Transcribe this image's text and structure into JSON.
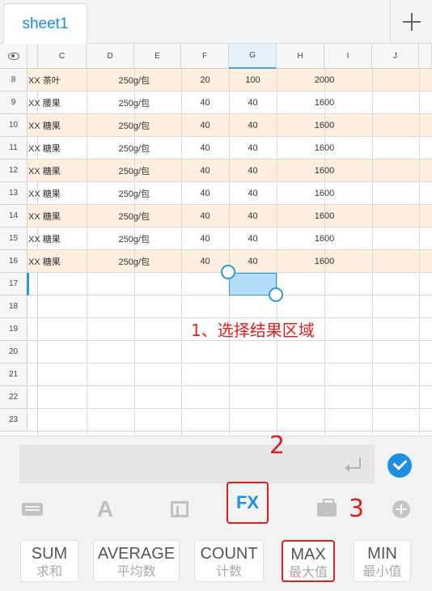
{
  "tabs": {
    "active": "sheet1"
  },
  "grid": {
    "columns": [
      "C",
      "D",
      "E",
      "F",
      "G",
      "H",
      "I",
      "J"
    ],
    "rows": [
      {
        "num": "8",
        "name": "XX 茶叶",
        "spec": "250g/包",
        "f": "20",
        "g": "100",
        "h": "2000"
      },
      {
        "num": "9",
        "name": "XX 腰果",
        "spec": "250g/包",
        "f": "40",
        "g": "40",
        "h": "1600"
      },
      {
        "num": "10",
        "name": "XX 糖果",
        "spec": "250g/包",
        "f": "40",
        "g": "40",
        "h": "1600"
      },
      {
        "num": "11",
        "name": "XX 糖果",
        "spec": "250g/包",
        "f": "40",
        "g": "40",
        "h": "1600"
      },
      {
        "num": "12",
        "name": "XX 糖果",
        "spec": "250g/包",
        "f": "40",
        "g": "40",
        "h": "1600"
      },
      {
        "num": "13",
        "name": "XX 糖果",
        "spec": "250g/包",
        "f": "40",
        "g": "40",
        "h": "1600"
      },
      {
        "num": "14",
        "name": "XX 糖果",
        "spec": "250g/包",
        "f": "40",
        "g": "40",
        "h": "1600"
      },
      {
        "num": "15",
        "name": "XX 糖果",
        "spec": "250g/包",
        "f": "40",
        "g": "40",
        "h": "1600"
      },
      {
        "num": "16",
        "name": "XX 糖果",
        "spec": "250g/包",
        "f": "40",
        "g": "40",
        "h": "1600"
      }
    ],
    "empty_rows": [
      "17",
      "18",
      "19",
      "20",
      "21",
      "22",
      "23"
    ],
    "selected_cell": "G17",
    "selection_color": "#b5ddf7"
  },
  "annotations": {
    "step1": "1、选择结果区域",
    "step2": "2",
    "step3": "3"
  },
  "formula_bar": {
    "value": ""
  },
  "toolbar": {
    "fx_label": "FX",
    "font_label": "A"
  },
  "functions": [
    {
      "name": "SUM",
      "cn": "求和"
    },
    {
      "name": "AVERAGE",
      "cn": "平均数"
    },
    {
      "name": "COUNT",
      "cn": "计数"
    },
    {
      "name": "MAX",
      "cn": "最大值"
    },
    {
      "name": "MIN",
      "cn": "最小值"
    }
  ],
  "colors": {
    "accent": "#1f8fe2",
    "annotation": "#e02020",
    "row_highlight": "#fdeee0"
  }
}
